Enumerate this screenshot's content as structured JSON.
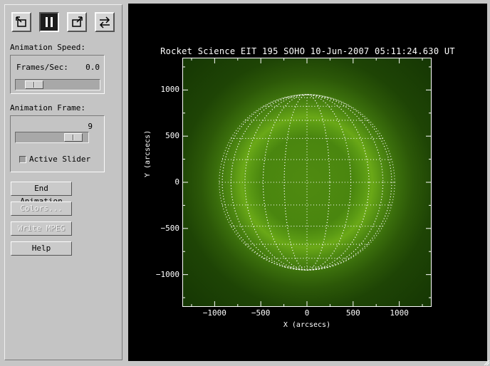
{
  "toolbar": {
    "buttons": [
      {
        "name": "step-backward-button",
        "icon": "rewind-arrow-icon"
      },
      {
        "name": "pause-button",
        "icon": "pause-icon"
      },
      {
        "name": "step-forward-button",
        "icon": "forward-arrow-icon"
      },
      {
        "name": "cycle-direction-button",
        "icon": "swap-arrows-icon"
      }
    ]
  },
  "speed": {
    "label": "Animation Speed:",
    "fps_label": "Frames/Sec:",
    "fps_value": "0.0",
    "slider_fraction": 0.12
  },
  "frame": {
    "label": "Animation Frame:",
    "value": "9",
    "slider_fraction": 0.92,
    "active_slider_label": "Active Slider"
  },
  "buttons": {
    "end_animation": "End Animation",
    "colors": "Colors...",
    "write_mpeg": "Write MPEG",
    "help": "Help"
  },
  "plot": {
    "title": "Rocket Science EIT 195 SOHO 10-Jun-2007 05:11:24.630 UT",
    "xlabel": "X (arcsecs)",
    "ylabel": "Y (arcsecs)",
    "xticks": [
      "−1000",
      "−500",
      "0",
      "500",
      "1000"
    ],
    "yticks": [
      "1000",
      "500",
      "0",
      "−500",
      "−1000"
    ],
    "xlim": [
      -1350,
      1350
    ],
    "ylim": [
      -1350,
      1350
    ],
    "solar_radius_arcsec": 950,
    "grid_spacing_deg": 15,
    "colors": {
      "background": "#000000",
      "disk": "#4f8a10",
      "limb_bright": "#6aa817",
      "grid": "#ffffff"
    }
  }
}
